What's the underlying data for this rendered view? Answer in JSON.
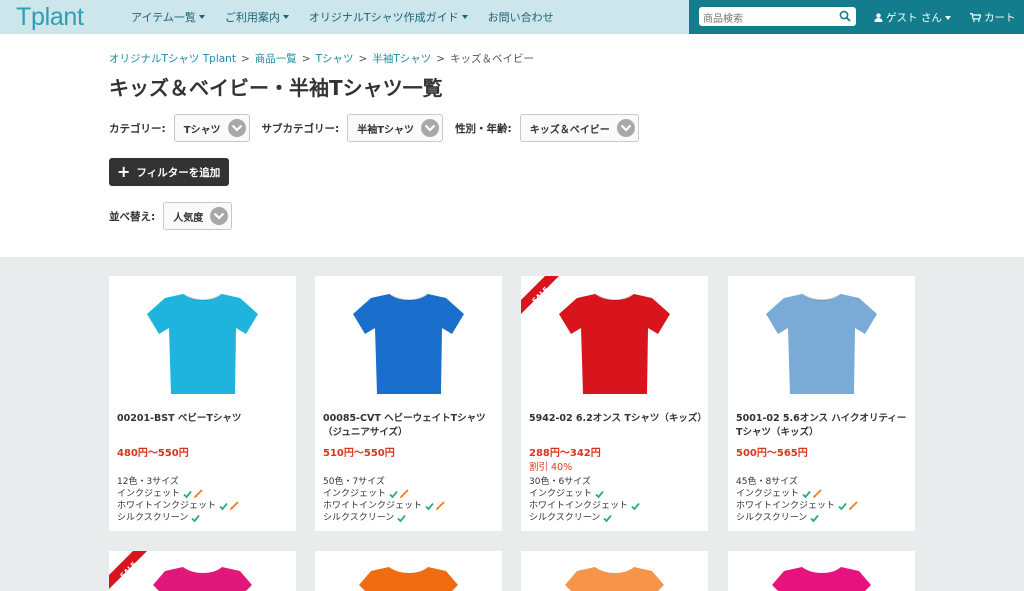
{
  "header": {
    "logo": "Tplant",
    "nav": [
      {
        "label": "アイテム一覧",
        "dropdown": true
      },
      {
        "label": "ご利用案内",
        "dropdown": true
      },
      {
        "label": "オリジナルTシャツ作成ガイド",
        "dropdown": true
      },
      {
        "label": "お問い合わせ",
        "dropdown": false
      }
    ],
    "search_placeholder": "商品検索",
    "guest_label": "ゲスト さん",
    "cart_label": "カート"
  },
  "breadcrumb": [
    "オリジナルTシャツ Tplant",
    "商品一覧",
    "Tシャツ",
    "半袖Tシャツ",
    "キッズ＆ベイビー"
  ],
  "page_title": "キッズ＆ベイビー・半袖Tシャツ一覧",
  "filters": {
    "category_label": "カテゴリー:",
    "category_value": "Tシャツ",
    "subcategory_label": "サブカテゴリー:",
    "subcategory_value": "半袖Tシャツ",
    "gender_label": "性別・年齢:",
    "gender_value": "キッズ＆ベイビー",
    "add_filter": "フィルターを追加",
    "sort_label": "並べ替え:",
    "sort_value": "人気度"
  },
  "products": [
    {
      "name": "00201-BST ベビーTシャツ",
      "price": "480円〜550円",
      "discount": "",
      "sizes": "12色・3サイズ",
      "color": "#1fb4de",
      "sale": false,
      "methods": [
        {
          "label": "インクジェット",
          "brush": true
        },
        {
          "label": "ホワイトインクジェット",
          "brush": true
        },
        {
          "label": "シルクスクリーン",
          "brush": false
        }
      ]
    },
    {
      "name": "00085-CVT ヘビーウェイトTシャツ（ジュニアサイズ）",
      "price": "510円〜550円",
      "discount": "",
      "sizes": "50色・7サイズ",
      "color": "#1a6fcc",
      "sale": false,
      "methods": [
        {
          "label": "インクジェット",
          "brush": true
        },
        {
          "label": "ホワイトインクジェット",
          "brush": true
        },
        {
          "label": "シルクスクリーン",
          "brush": false
        }
      ]
    },
    {
      "name": "5942-02 6.2オンス Tシャツ（キッズ）",
      "price": "288円〜342円",
      "discount": "割引 40%",
      "sizes": "30色・6サイズ",
      "color": "#d8141c",
      "sale": true,
      "methods": [
        {
          "label": "インクジェット",
          "brush": false
        },
        {
          "label": "ホワイトインクジェット",
          "brush": false
        },
        {
          "label": "シルクスクリーン",
          "brush": false
        }
      ]
    },
    {
      "name": "5001-02 5.6オンス ハイクオリティーTシャツ（キッズ）",
      "price": "500円〜565円",
      "discount": "",
      "sizes": "45色・8サイズ",
      "color": "#7aaad6",
      "sale": false,
      "methods": [
        {
          "label": "インクジェット",
          "brush": true
        },
        {
          "label": "ホワイトインクジェット",
          "brush": true
        },
        {
          "label": "シルクスクリーン",
          "brush": false
        }
      ]
    }
  ],
  "products_row2": [
    {
      "color": "#e0187a",
      "sale": true
    },
    {
      "color": "#f06c12",
      "sale": false
    },
    {
      "color": "#f6944a",
      "sale": false
    },
    {
      "color": "#e8127e",
      "sale": false
    }
  ],
  "sale_label": "SALE",
  "colors": {
    "accent": "#147d8d",
    "price": "#d9341c",
    "check": "#2aaa8a",
    "brush": "#f07a22"
  }
}
